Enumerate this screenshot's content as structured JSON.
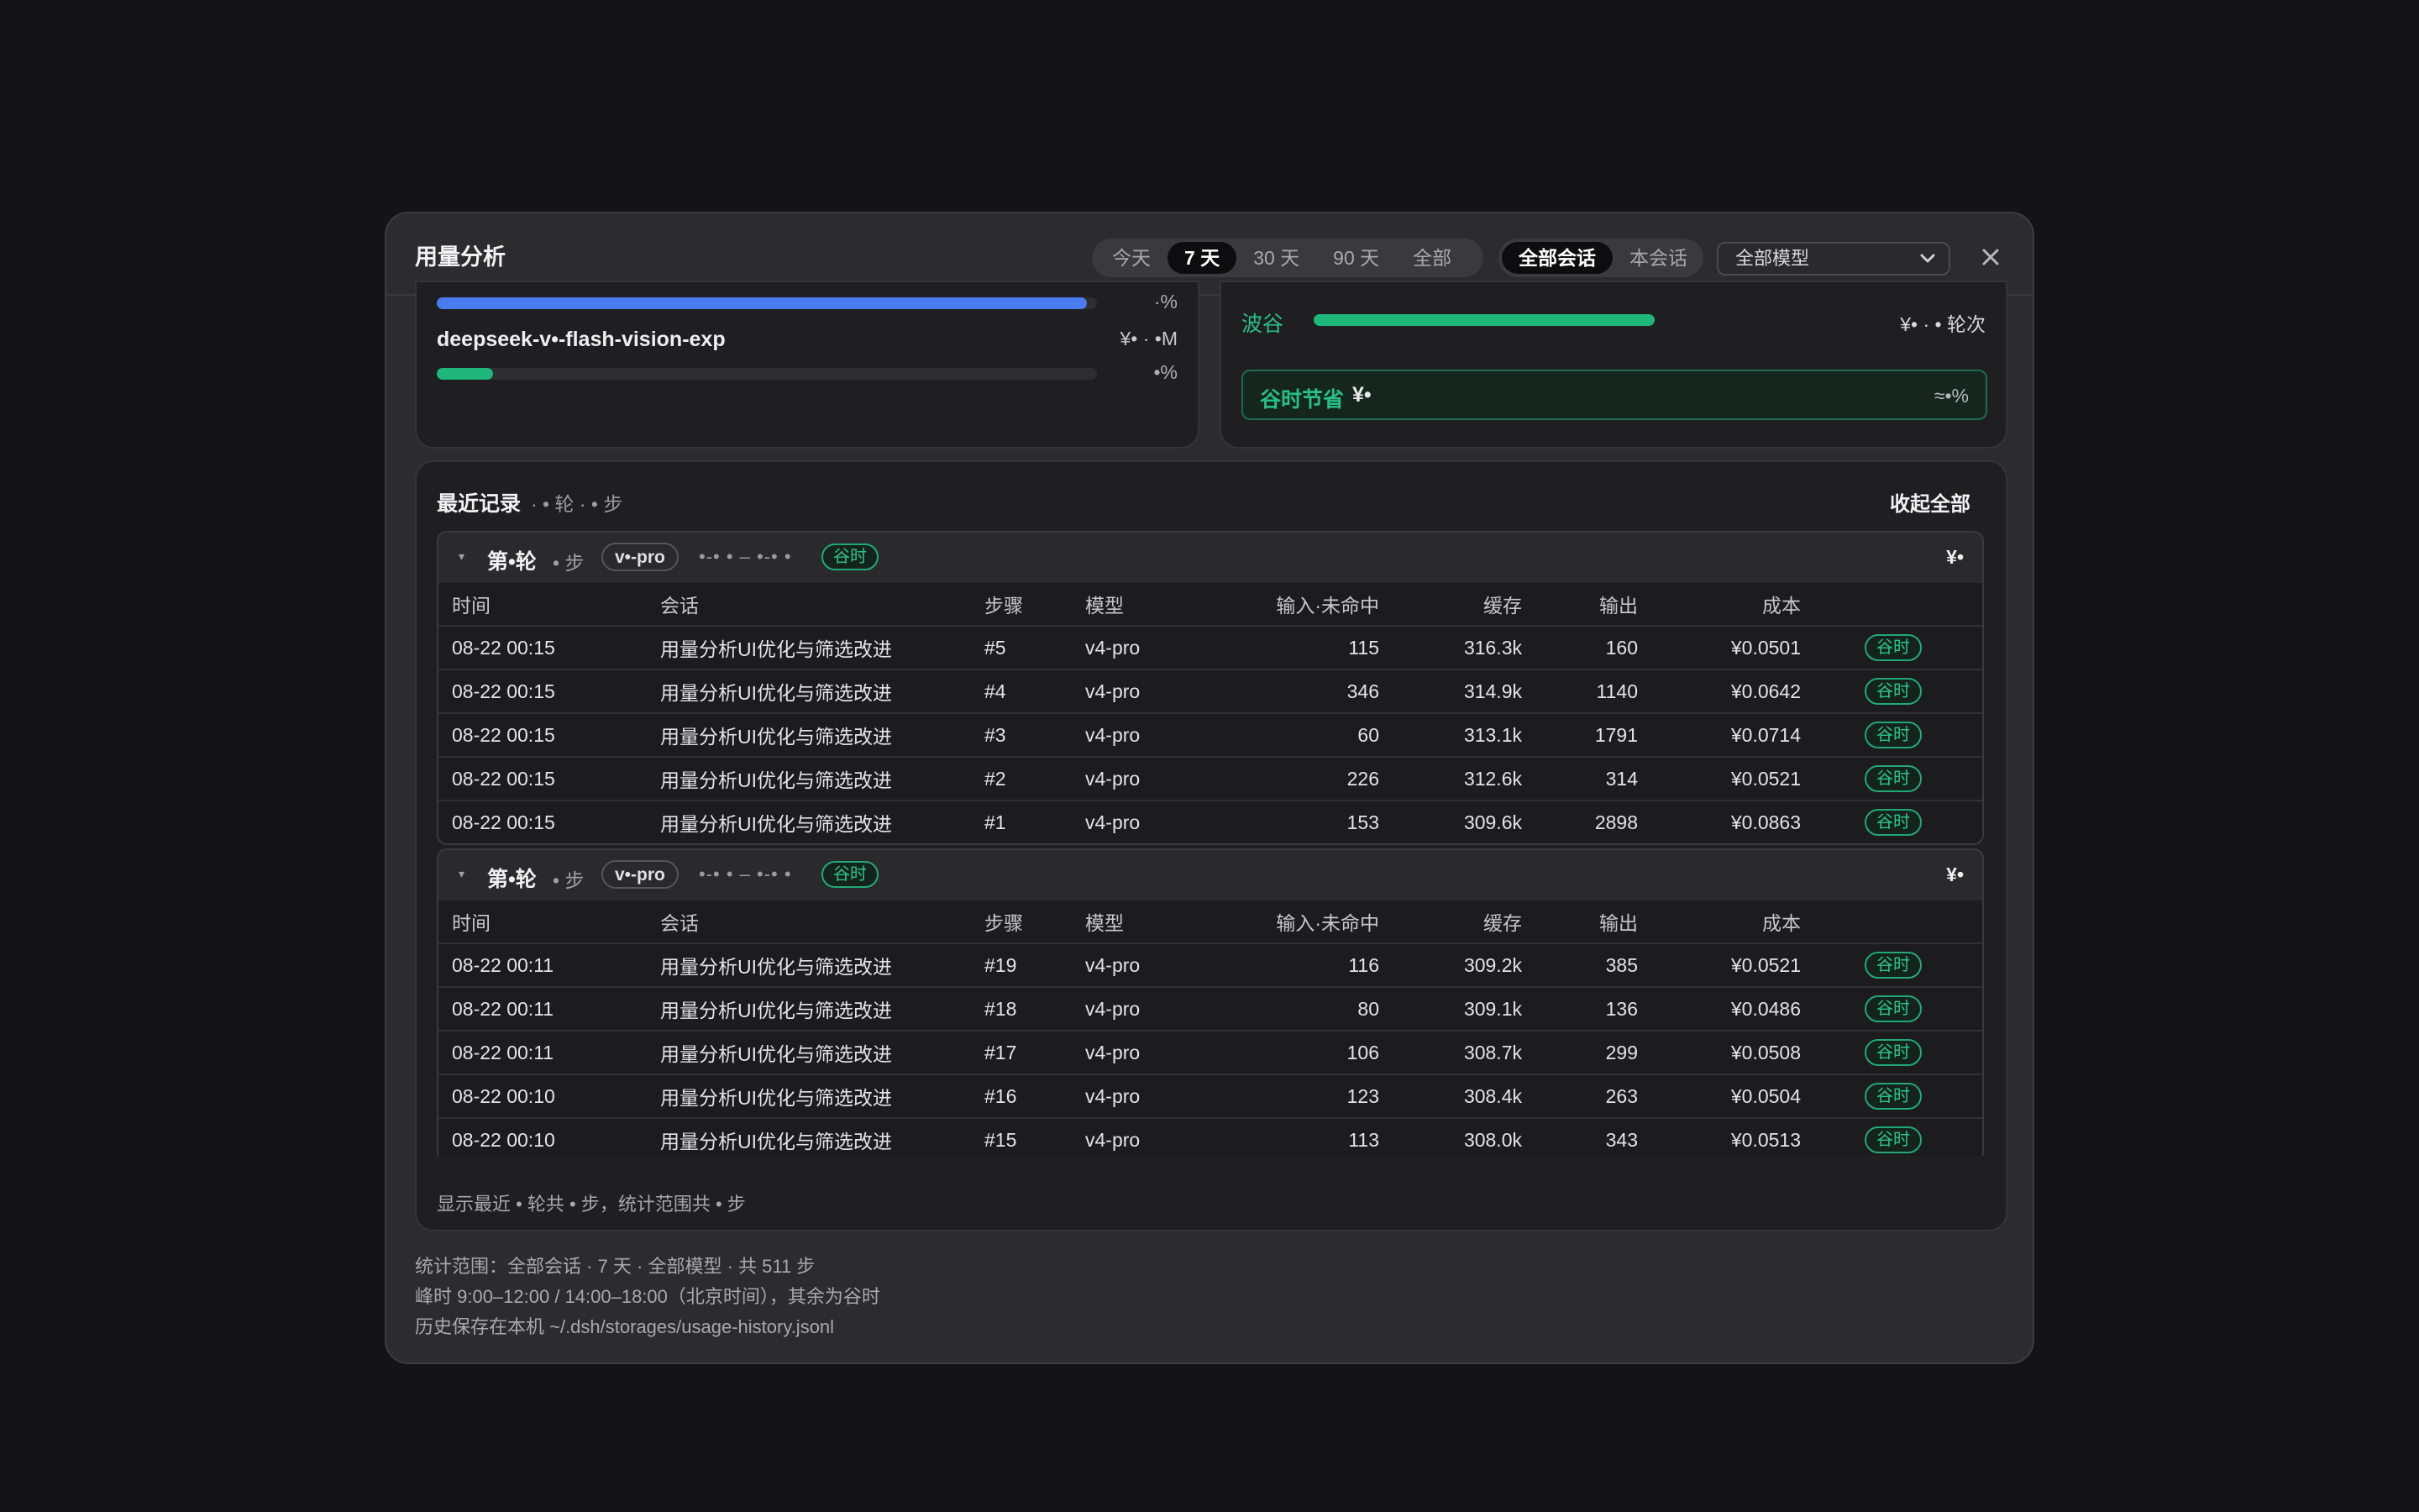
{
  "modal": {
    "title": "用量分析",
    "range_options": [
      "今天",
      "7 天",
      "30 天",
      "90 天",
      "全部"
    ],
    "range_active": "7 天",
    "scope_options": [
      "全部会话",
      "本会话"
    ],
    "scope_active": "全部会话",
    "model_select": "全部模型",
    "close_glyph": "✕"
  },
  "models_panel": {
    "bar1": {
      "pct_label": "·%",
      "fill": 0.985,
      "color": "#4a7cf0"
    },
    "model2": {
      "name": "deepseek-v•-flash-vision-exp",
      "value": "¥• · •M",
      "pct_label": "•%",
      "fill": 0.085,
      "color": "#1fb67c"
    }
  },
  "period_panel": {
    "label": "波谷",
    "fill": 0.72,
    "color": "#1fb67c",
    "value": "¥• · • 轮次",
    "save_label": "谷时节省",
    "save_amount": "¥•",
    "save_ratio": "≈•%"
  },
  "records": {
    "title": "最近记录",
    "subtitle": "· • 轮 · • 步",
    "collapse_label": "收起全部",
    "columns": [
      "时间",
      "会话",
      "步骤",
      "模型",
      "输入·未命中",
      "缓存",
      "输出",
      "成本",
      ""
    ],
    "rounds": [
      {
        "title": "第•轮",
        "steps": "• 步",
        "model": "v•-pro",
        "dots": "•-• • – •-• •",
        "tag": "谷时",
        "cost": "¥•",
        "rows": [
          {
            "time": "08-22 00:15",
            "session": "用量分析UI优化与筛选改进",
            "step": "#5",
            "model": "v4-pro",
            "input": "115",
            "cache": "316.3k",
            "output": "160",
            "cost": "¥0.0501",
            "tag": "谷时"
          },
          {
            "time": "08-22 00:15",
            "session": "用量分析UI优化与筛选改进",
            "step": "#4",
            "model": "v4-pro",
            "input": "346",
            "cache": "314.9k",
            "output": "1140",
            "cost": "¥0.0642",
            "tag": "谷时"
          },
          {
            "time": "08-22 00:15",
            "session": "用量分析UI优化与筛选改进",
            "step": "#3",
            "model": "v4-pro",
            "input": "60",
            "cache": "313.1k",
            "output": "1791",
            "cost": "¥0.0714",
            "tag": "谷时"
          },
          {
            "time": "08-22 00:15",
            "session": "用量分析UI优化与筛选改进",
            "step": "#2",
            "model": "v4-pro",
            "input": "226",
            "cache": "312.6k",
            "output": "314",
            "cost": "¥0.0521",
            "tag": "谷时"
          },
          {
            "time": "08-22 00:15",
            "session": "用量分析UI优化与筛选改进",
            "step": "#1",
            "model": "v4-pro",
            "input": "153",
            "cache": "309.6k",
            "output": "2898",
            "cost": "¥0.0863",
            "tag": "谷时"
          }
        ]
      },
      {
        "title": "第•轮",
        "steps": "• 步",
        "model": "v•-pro",
        "dots": "•-• • – •-• •",
        "tag": "谷时",
        "cost": "¥•",
        "rows": [
          {
            "time": "08-22 00:11",
            "session": "用量分析UI优化与筛选改进",
            "step": "#19",
            "model": "v4-pro",
            "input": "116",
            "cache": "309.2k",
            "output": "385",
            "cost": "¥0.0521",
            "tag": "谷时"
          },
          {
            "time": "08-22 00:11",
            "session": "用量分析UI优化与筛选改进",
            "step": "#18",
            "model": "v4-pro",
            "input": "80",
            "cache": "309.1k",
            "output": "136",
            "cost": "¥0.0486",
            "tag": "谷时"
          },
          {
            "time": "08-22 00:11",
            "session": "用量分析UI优化与筛选改进",
            "step": "#17",
            "model": "v4-pro",
            "input": "106",
            "cache": "308.7k",
            "output": "299",
            "cost": "¥0.0508",
            "tag": "谷时"
          },
          {
            "time": "08-22 00:10",
            "session": "用量分析UI优化与筛选改进",
            "step": "#16",
            "model": "v4-pro",
            "input": "123",
            "cache": "308.4k",
            "output": "263",
            "cost": "¥0.0504",
            "tag": "谷时"
          },
          {
            "time": "08-22 00:10",
            "session": "用量分析UI优化与筛选改进",
            "step": "#15",
            "model": "v4-pro",
            "input": "113",
            "cache": "308.0k",
            "output": "343",
            "cost": "¥0.0513",
            "tag": "谷时"
          }
        ]
      }
    ],
    "footnote": "显示最近 • 轮共 • 步，统计范围共 • 步"
  },
  "meta": {
    "line1": "统计范围：全部会话 · 7 天 · 全部模型 · 共 511 步",
    "line2": "峰时 9:00–12:00 / 14:00–18:00（北京时间），其余为谷时",
    "line3": "历史保存在本机 ~/.dsh/storages/usage-history.jsonl"
  },
  "colors": {
    "accent_green": "#22a877",
    "accent_blue": "#4a7cf0",
    "background": "#141416",
    "modal": "#2c2c2f"
  }
}
